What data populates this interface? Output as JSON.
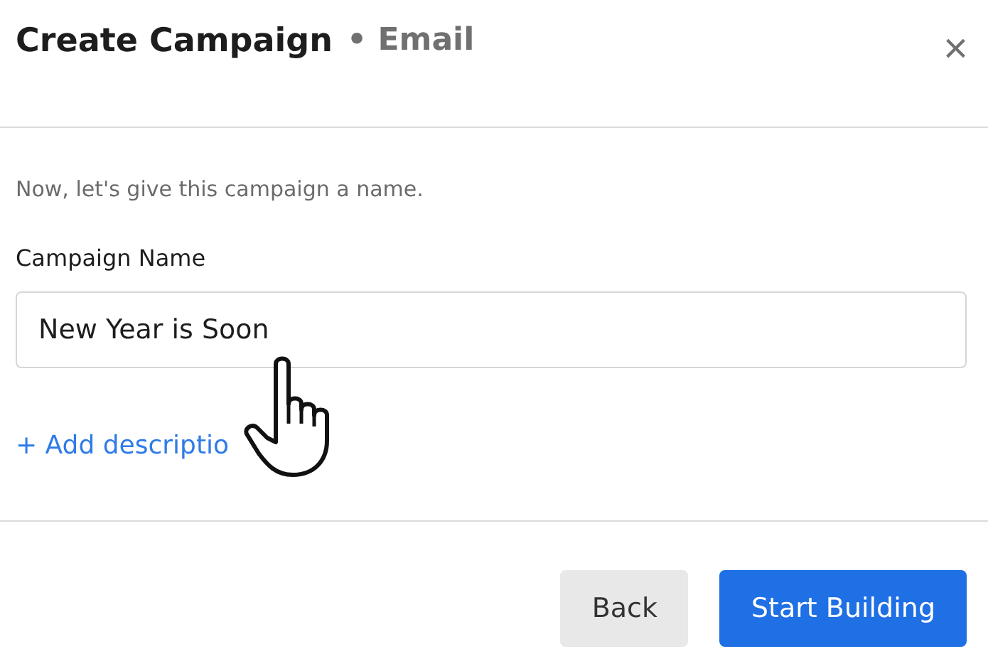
{
  "dialog": {
    "title": "Create Campaign",
    "subtitle": "• Email",
    "close": "×"
  },
  "intro": "Now, let's give this campaign a name.",
  "field": {
    "label": "Campaign Name",
    "value": "New Year is Soon"
  },
  "link": "+ Add descriptio",
  "buttons": [
    {
      "label": "Back",
      "kind": "secondary"
    },
    {
      "label": "Start Building",
      "kind": "primary"
    }
  ]
}
